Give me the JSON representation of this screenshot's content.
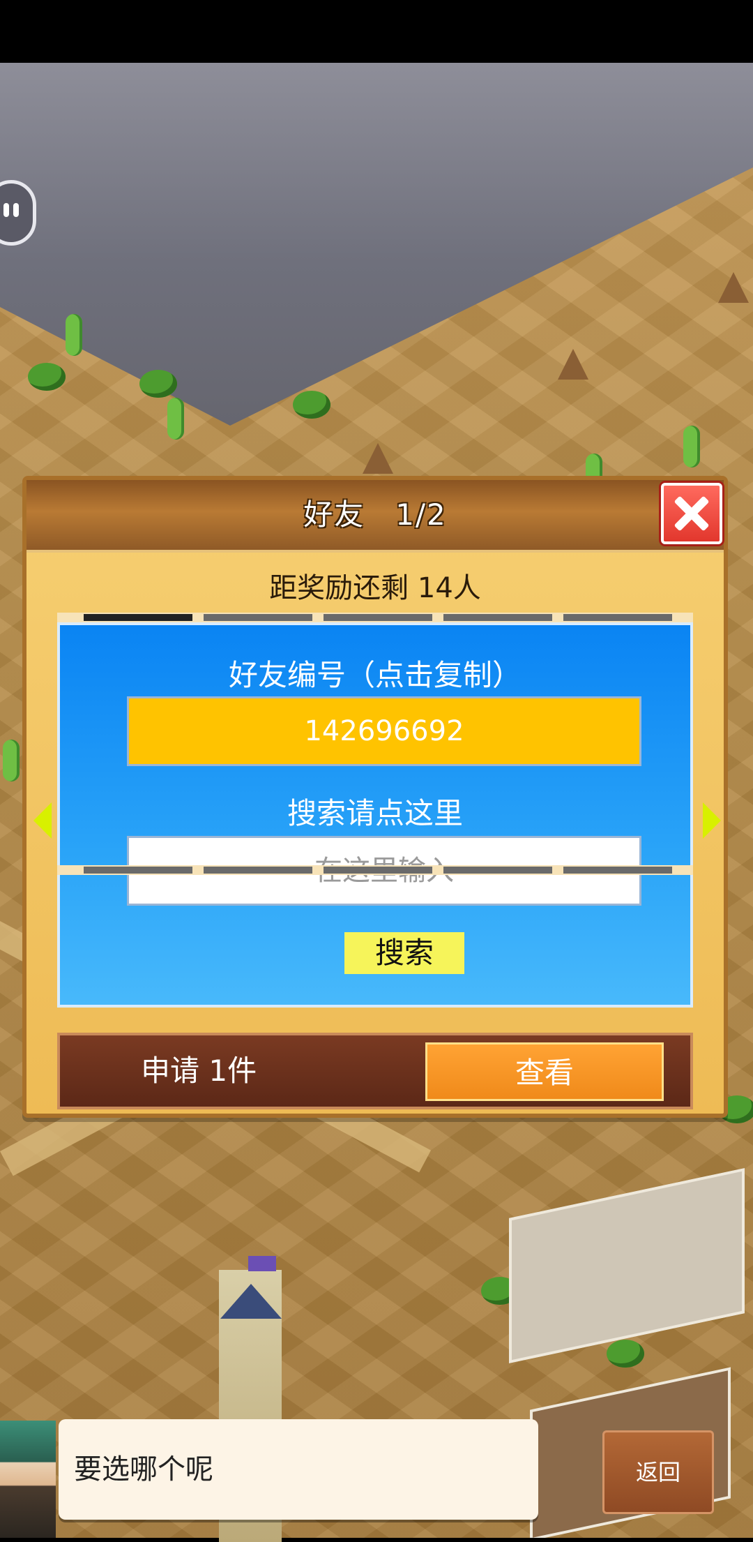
{
  "dialog": {
    "title": "好友　1/2",
    "reward_text": "距奖励还剩 14人"
  },
  "friend_panel": {
    "id_label": "好友编号（点击复制）",
    "friend_id": "142696692",
    "search_label": "搜索请点这里",
    "search_placeholder": "在这里输入",
    "search_button": "搜索"
  },
  "request_bar": {
    "request_text": "申请 1件",
    "view_button": "查看"
  },
  "bottom": {
    "speech_text": "要选哪个呢",
    "back_button": "返回"
  },
  "icons": [
    "close-icon",
    "arrow-left-icon",
    "arrow-right-icon",
    "chat-bubble-icon"
  ],
  "colors": {
    "id_box": "#ffc300",
    "panel_blue": "#0a84f3",
    "view_button": "#f08a1a",
    "search_button": "#f6f45a",
    "close_red": "#e2372d"
  }
}
